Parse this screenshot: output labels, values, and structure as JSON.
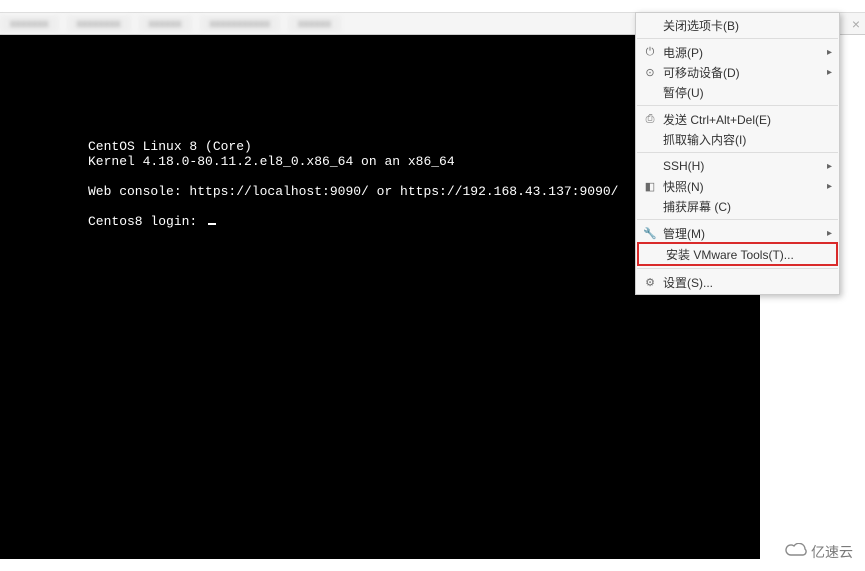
{
  "terminal": {
    "line1": "CentOS Linux 8 (Core)",
    "line2": "Kernel 4.18.0-80.11.2.el8_0.x86_64 on an x86_64",
    "line3": "Web console: https://localhost:9090/ or https://192.168.43.137:9090/",
    "line4": "Centos8 login: "
  },
  "tabs": {
    "close": "×"
  },
  "menu": {
    "close_tab": "关闭选项卡(B)",
    "power": "电源(P)",
    "removable": "可移动设备(D)",
    "pause": "暂停(U)",
    "send_cad": "发送 Ctrl+Alt+Del(E)",
    "grab_input": "抓取输入内容(I)",
    "ssh": "SSH(H)",
    "snapshot": "快照(N)",
    "capture": "捕获屏幕 (C)",
    "manage": "管理(M)",
    "install_tools": "安装 VMware Tools(T)...",
    "settings": "设置(S)..."
  },
  "watermark": {
    "text": "亿速云"
  }
}
